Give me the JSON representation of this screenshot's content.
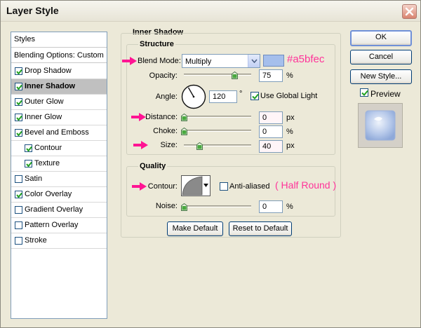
{
  "window": {
    "title": "Layer Style"
  },
  "styles": {
    "header": "Styles",
    "blending": "Blending Options: Custom",
    "items": [
      {
        "label": "Drop Shadow",
        "checked": true
      },
      {
        "label": "Inner Shadow",
        "checked": true,
        "active": true
      },
      {
        "label": "Outer Glow",
        "checked": true
      },
      {
        "label": "Inner Glow",
        "checked": true
      },
      {
        "label": "Bevel and Emboss",
        "checked": true
      },
      {
        "label": "Contour",
        "checked": true
      },
      {
        "label": "Texture",
        "checked": true
      },
      {
        "label": "Satin",
        "checked": false
      },
      {
        "label": "Color Overlay",
        "checked": true
      },
      {
        "label": "Gradient Overlay",
        "checked": false
      },
      {
        "label": "Pattern Overlay",
        "checked": false
      },
      {
        "label": "Stroke",
        "checked": false
      }
    ]
  },
  "inner_shadow": {
    "section_title": "Inner Shadow",
    "structure_title": "Structure",
    "blend_mode_label": "Blend Mode:",
    "blend_mode_value": "Multiply",
    "shadow_color": "#a5bfec",
    "opacity_label": "Opacity:",
    "opacity_value": "75",
    "opacity_unit": "%",
    "opacity_level": 0.75,
    "angle_label": "Angle:",
    "angle_value": "120",
    "angle_unit": "°",
    "use_global_light_label": "Use Global Light",
    "use_global_light_checked": true,
    "distance_label": "Distance:",
    "distance_value": "0",
    "distance_unit": "px",
    "choke_label": "Choke:",
    "choke_value": "0",
    "choke_unit": "%",
    "size_label": "Size:",
    "size_value": "40",
    "size_unit": "px",
    "quality_title": "Quality",
    "contour_label": "Contour:",
    "anti_aliased_label": "Anti-aliased",
    "anti_aliased_checked": false,
    "noise_label": "Noise:",
    "noise_value": "0",
    "noise_unit": "%",
    "make_default_label": "Make Default",
    "reset_default_label": "Reset to Default"
  },
  "annotations": {
    "color_note": "#a5bfec",
    "contour_note": "( Half Round )",
    "arrow_color": "#ff1493"
  },
  "buttons": {
    "ok": "OK",
    "cancel": "Cancel",
    "new_style": "New Style...",
    "preview_label": "Preview",
    "preview_checked": true
  },
  "colors": {
    "window_bg": "#ece9d8",
    "active_item_bg": "#c0c0c0",
    "input_border": "#7f9db9",
    "annotation_pink": "#ff3399"
  }
}
